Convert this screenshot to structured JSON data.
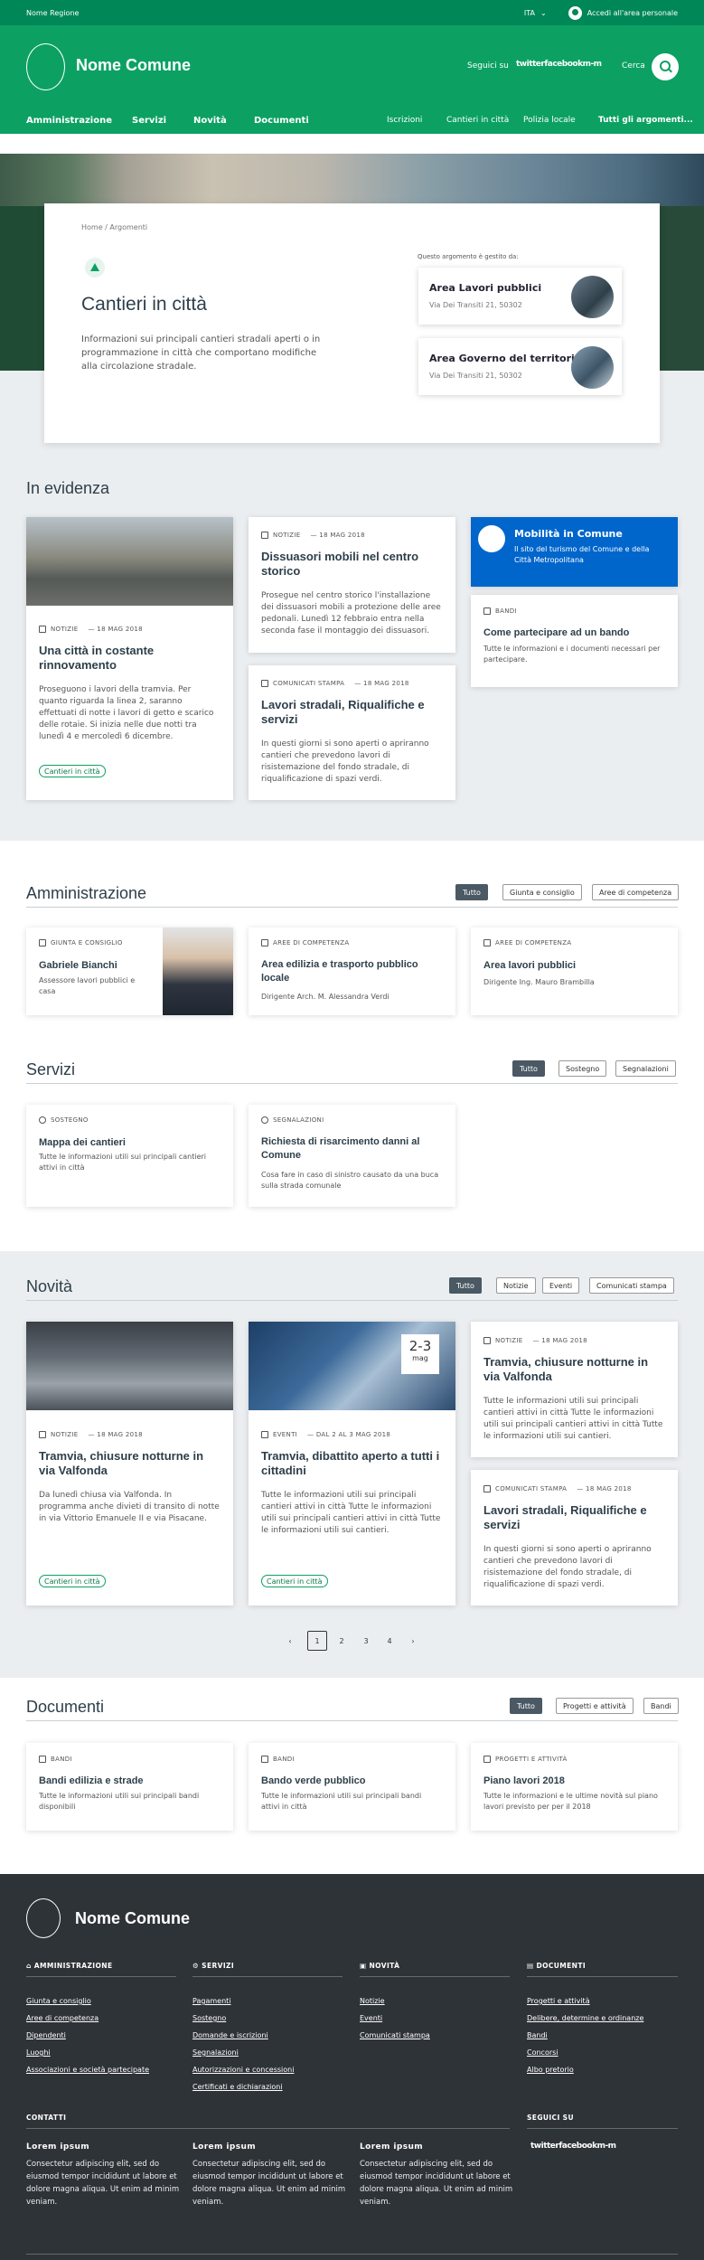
{
  "topbar": {
    "region": "Nome Regione",
    "lang": "ITA",
    "login": "Accedi all'area personale"
  },
  "header": {
    "comune": "Nome Comune",
    "follow": "Seguici su",
    "social": "twitterfacebookm-m",
    "search": "Cerca"
  },
  "nav": {
    "main": [
      "Amministrazione",
      "Servizi",
      "Novità",
      "Documenti"
    ],
    "secondary": [
      "Iscrizioni",
      "Cantieri in città",
      "Polizia locale"
    ],
    "all": "Tutti gli argomenti..."
  },
  "hero": {
    "breadcrumb": "Home / Argomenti",
    "title": "Cantieri in città",
    "desc": "Informazioni sui principali cantieri stradali aperti o in programmazione in città che comportano modifiche alla circolazione stradale.",
    "managed": "Questo argomento è gestito da:",
    "offices": [
      {
        "title": "Area Lavori pubblici",
        "addr": "Via Dei Transiti 21, 50302"
      },
      {
        "title": "Area Governo del territorio",
        "addr": "Via Dei Transiti 21, 50302"
      }
    ]
  },
  "evidenza": {
    "title": "In evidenza",
    "c1": {
      "cat": "NOTIZIE",
      "date": "— 18 MAG 2018",
      "title": "Una città in costante rinnovamento",
      "desc": "Proseguono i lavori della tramvia. Per quanto riguarda la linea 2, saranno effettuati di notte i lavori di getto e scarico delle rotaie. Si inizia nelle due notti tra lunedì 4 e mercoledì 6 dicembre.",
      "chip": "Cantieri in città"
    },
    "c2": {
      "cat": "NOTIZIE",
      "date": "— 18 MAG 2018",
      "title": "Dissuasori mobili nel centro storico",
      "desc": "Prosegue nel centro storico l'installazione dei dissuasori mobili a protezione delle aree pedonali. Lunedì 12 febbraio entra nella seconda fase il montaggio dei dissuasori."
    },
    "c3": {
      "cat": "COMUNICATI STAMPA",
      "date": "— 18 MAG 2018",
      "title": "Lavori stradali, Riqualifiche e servizi",
      "desc": "In questi giorni si sono aperti o apriranno cantieri che prevedono lavori di risistemazione del fondo stradale, di riqualificazione di spazi verdi."
    },
    "c4": {
      "title": "Mobilità in Comune",
      "desc": "Il sito del turismo del Comune e della Città Metropolitana"
    },
    "c5": {
      "cat": "BANDI",
      "title": "Come partecipare ad un bando",
      "desc": "Tutte le informazioni e i documenti necessari per partecipare."
    }
  },
  "amm": {
    "title": "Amministrazione",
    "filters": [
      "Tutto",
      "Giunta e consiglio",
      "Aree di competenza"
    ],
    "cards": [
      {
        "cat": "GIUNTA E CONSIGLIO",
        "title": "Gabriele Bianchi",
        "desc": "Assessore lavori pubblici e casa"
      },
      {
        "cat": "AREE DI COMPETENZA",
        "title": "Area edilizia e trasporto pubblico locale",
        "desc": "Dirigente Arch. M. Alessandra Verdi"
      },
      {
        "cat": "AREE DI COMPETENZA",
        "title": "Area lavori pubblici",
        "desc": "Dirigente Ing. Mauro Brambilla"
      }
    ]
  },
  "servizi": {
    "title": "Servizi",
    "filters": [
      "Tutto",
      "Sostegno",
      "Segnalazioni"
    ],
    "cards": [
      {
        "cat": "SOSTEGNO",
        "title": "Mappa dei cantieri",
        "desc": "Tutte le informazioni utili sui principali cantieri attivi in città"
      },
      {
        "cat": "SEGNALAZIONI",
        "title": "Richiesta di risarcimento danni al Comune",
        "desc": "Cosa fare in caso di sinistro causato da una buca sulla strada comunale"
      }
    ]
  },
  "novita": {
    "title": "Novità",
    "filters": [
      "Tutto",
      "Notizie",
      "Eventi",
      "Comunicati stampa"
    ],
    "c1": {
      "cat": "NOTIZIE",
      "date": "— 18 MAG 2018",
      "title": "Tramvia, chiusure notturne in via Valfonda",
      "desc": "Da lunedì chiusa via Valfonda. In programma anche divieti di transito di notte in via Vittorio Emanuele II e via Pisacane.",
      "chip": "Cantieri in città"
    },
    "c2": {
      "cat": "EVENTI",
      "date": "— DAL 2 AL 3 MAG 2018",
      "title": "Tramvia, dibattito aperto a tutti i cittadini",
      "desc": "Tutte le informazioni utili sui principali cantieri attivi in città Tutte le informazioni utili sui principali cantieri attivi in città Tutte le informazioni utili sui cantieri.",
      "chip": "Cantieri in città",
      "badge1": "2-3",
      "badge2": "mag"
    },
    "c3": {
      "cat": "NOTIZIE",
      "date": "— 18 MAG 2018",
      "title": "Tramvia, chiusure notturne in via Valfonda",
      "desc": "Tutte le informazioni utili sui principali cantieri attivi in città Tutte le informazioni utili sui principali cantieri attivi in città Tutte le informazioni utili sui cantieri."
    },
    "c4": {
      "cat": "COMUNICATI STAMPA",
      "date": "— 18 MAG 2018",
      "title": "Lavori stradali, Riqualifiche e servizi",
      "desc": "In questi giorni si sono aperti o apriranno cantieri che prevedono lavori di risistemazione del fondo stradale, di riqualificazione di spazi verdi."
    },
    "pages": [
      "1",
      "2",
      "3",
      "4"
    ]
  },
  "documenti": {
    "title": "Documenti",
    "filters": [
      "Tutto",
      "Progetti e attività",
      "Bandi"
    ],
    "cards": [
      {
        "cat": "BANDI",
        "title": "Bandi edilizia e strade",
        "desc": "Tutte le informazioni utili sui principali bandi disponibili"
      },
      {
        "cat": "BANDI",
        "title": "Bando verde pubblico",
        "desc": "Tutte le informazioni utili sui principali bandi attivi in città"
      },
      {
        "cat": "PROGETTI E ATTIVITÀ",
        "title": "Piano lavori 2018",
        "desc": "Tutte le informazioni e le ultime novità sul piano lavori previsto per per il 2018"
      }
    ]
  },
  "footer": {
    "comune": "Nome Comune",
    "cols": [
      {
        "title": "AMMINISTRAZIONE",
        "links": [
          "Giunta e consiglio",
          "Aree di competenza",
          "Dipendenti",
          "Luoghi",
          "Associazioni e società partecipate"
        ]
      },
      {
        "title": "SERVIZI",
        "links": [
          "Pagamenti",
          "Sostegno",
          "Domande e iscrizioni",
          "Segnalazioni",
          "Autorizzazioni e concessioni",
          "Certificati e dichiarazioni"
        ]
      },
      {
        "title": "NOVITÀ",
        "links": [
          "Notizie",
          "Eventi",
          "Comunicati stampa"
        ]
      },
      {
        "title": "DOCUMENTI",
        "links": [
          "Progetti e attività",
          "Delibere, determine e ordinanze",
          "Bandi",
          "Concorsi",
          "Albo pretorio"
        ]
      }
    ],
    "contatti": "CONTATTI",
    "seguici": "SEGUICI SU",
    "social": "twitterfacebookm-m",
    "blocks": [
      {
        "title": "Lorem ipsum",
        "text": "Consectetur adipiscing elit, sed do eiusmod tempor incididunt ut labore et dolore magna aliqua. Ut enim ad minim veniam."
      },
      {
        "title": "Lorem ipsum",
        "text": "Consectetur adipiscing elit, sed do eiusmod tempor incididunt ut labore et dolore magna aliqua. Ut enim ad minim veniam."
      },
      {
        "title": "Lorem ipsum",
        "text": "Consectetur adipiscing elit, sed do eiusmod tempor incididunt ut labore et dolore magna aliqua. Ut enim ad minim veniam."
      }
    ]
  }
}
